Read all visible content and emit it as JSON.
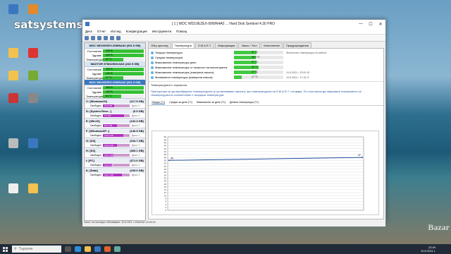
{
  "watermark": {
    "brand": "satsystems",
    "site": "Bazar"
  },
  "desktop_icons": [
    {
      "label": "",
      "color": "#3a77c0"
    },
    {
      "label": "",
      "color": "#e38a2a"
    },
    {
      "label": "",
      "color": "#f2c14e"
    },
    {
      "label": "",
      "color": "#d33"
    },
    {
      "label": "",
      "color": "#f2c14e"
    },
    {
      "label": "",
      "color": "#7a3"
    },
    {
      "label": "",
      "color": "#c33"
    },
    {
      "label": "",
      "color": "#888"
    },
    {
      "label": "",
      "color": "#bbb"
    },
    {
      "label": "",
      "color": "#3a77c0"
    },
    {
      "label": "",
      "color": "#eee"
    },
    {
      "label": "",
      "color": "#f2c14e"
    }
  ],
  "window": {
    "title": "[ 1 ] WDC WD10EZEX-00WN4A0 ...  Hard Disk Sentinel 4.30 PRO",
    "menu": [
      "Диск",
      "Отчет",
      "Изглед",
      "Конфигурация",
      "Инструменти",
      "Помощ"
    ],
    "minimize": "—",
    "maximize": "☐",
    "close": "✕"
  },
  "disks": [
    {
      "name": "WDC WD10EZEX-00WN4A0 (931.5 GB)",
      "selected": false,
      "metrics": [
        {
          "label": "Състояние",
          "value": "100 %",
          "pct": 100
        },
        {
          "label": "Здраве",
          "value": "100 %",
          "pct": 100
        },
        {
          "label": "Температура",
          "value": "37 °C",
          "pct": 50
        }
      ]
    },
    {
      "name": "MAXTOR STM3250310AS (232.9 GB)",
      "selected": false,
      "metrics": [
        {
          "label": "Състояние",
          "value": "100 %",
          "pct": 100
        },
        {
          "label": "Здраве",
          "value": "100 %",
          "pct": 100
        },
        {
          "label": "Температура",
          "value": "37 °C",
          "pct": 50
        }
      ]
    },
    {
      "name": "WDC WD10EZEX-00WN4A0 (931.5 GB)",
      "selected": true,
      "metrics": [
        {
          "label": "Състояние",
          "value": "100 %",
          "pct": 100
        },
        {
          "label": "Здраве",
          "value": "100 %",
          "pct": 100
        },
        {
          "label": "Температура",
          "value": "34 °C",
          "pct": 45
        }
      ]
    }
  ],
  "volumes": [
    {
      "name": "C: [Windows10]",
      "size": "(217.5 GB)",
      "free_label": "Свободно",
      "free": "93.8 GB",
      "pct": 43,
      "disk": "Диск: 0"
    },
    {
      "name": "D: [System Rese...]",
      "size": "(0.5 GB)",
      "free_label": "Свободно",
      "free": "0.4 GB",
      "pct": 80,
      "disk": "Диск: 0"
    },
    {
      "name": "E: [Win10]",
      "size": "(132.3 GB)",
      "free_label": "Свободно",
      "free": "69.2 GB",
      "pct": 52,
      "disk": "Диск: 0"
    },
    {
      "name": "F: [WindowsXP...]",
      "size": "(146.5 GB)",
      "free_label": "Свободно",
      "free": "109.5 GB",
      "pct": 75,
      "disk": "Диск: 1"
    },
    {
      "name": "G: [D3]",
      "size": "(194.7 GB)",
      "free_label": "Свободно",
      "free": "100.6 GB",
      "pct": 52,
      "disk": "Диск: 1"
    },
    {
      "name": "H: [D3]",
      "size": "(365.1 GB)",
      "free_label": "Свободно",
      "free": "145.7 GB",
      "pct": 40,
      "disk": "Диск: 2"
    },
    {
      "name": "I: [PC]",
      "size": "(371.6 GB)",
      "free_label": "Свободно",
      "free": "124.3 GB",
      "pct": 33,
      "disk": "Диск: 2"
    },
    {
      "name": "K: [Data]",
      "size": "(195.0 GB)",
      "free_label": "Свободно",
      "free": "140.7 GB",
      "pct": 72,
      "disk": "Диск: 2"
    }
  ],
  "tabs": [
    "Общ преглед",
    "Температура",
    "S.M.A.R.T.",
    "Информация",
    "Запис / Тест",
    "Изпълнение",
    "Предупреждения"
  ],
  "active_tab": 1,
  "temps": [
    {
      "label": "Текуща температура:",
      "value": "37 °C",
      "pct": 45,
      "extra": "Желателна температура на работа"
    },
    {
      "label": "Средна температура:",
      "value": "36.9 °C",
      "pct": 44,
      "extra": ""
    },
    {
      "label": "Максимална температура днес:",
      "value": "37 °C",
      "pct": 45,
      "extra": ""
    },
    {
      "label": "Максимална температура от началото на мониторинга:",
      "value": "40 °C",
      "pct": 50,
      "extra": ""
    },
    {
      "label": "Максимална температура (измерена някога):",
      "value": "37 °C",
      "pct": 45,
      "extra": "10.6.2021 г. 22:00:15"
    },
    {
      "label": "Минимална температура (измерена някога):",
      "value": "17 °C",
      "pct": 15,
      "extra": "10.6.2021 г. 17:15:17"
    }
  ],
  "status_note": "Температурата е нормална.",
  "hint": "Препоръчва се да калибрирате температурата (с установяване наклон), ако температурата на S.M.A.R.T. отговаря. По този начин да направите показанието на температурата в съответствие с текущата температура.",
  "subtabs": [
    "Текущо (°C)",
    "Средно за деня (°C)",
    "Максимално за деня (°C)",
    "Дневна температура (°C)"
  ],
  "chart_data": {
    "type": "line",
    "ylim": [
      0,
      50
    ],
    "ytick_step": 2,
    "series": [
      {
        "values": [
          34,
          34.5,
          35,
          35.5,
          36
        ]
      }
    ],
    "point_labels": [
      "34",
      "37"
    ],
    "color": "#1f4e9c"
  },
  "statusbar": "Часът на последно обновяване: 10.6.2021 г. Изпитни: 22:40:15",
  "taskbar": {
    "search_placeholder": "Търсене",
    "time": "22:40",
    "date": "10.6.2021 г."
  }
}
